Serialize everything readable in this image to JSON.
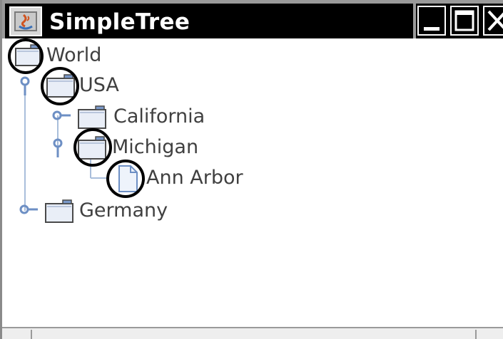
{
  "window": {
    "title": "SimpleTree",
    "controls": [
      "minimize-icon",
      "maximize-icon",
      "close-icon"
    ]
  },
  "tree": {
    "nodes": [
      {
        "label": "World",
        "icon": "folder-icon",
        "depth": 0,
        "handle": "none",
        "marked": true
      },
      {
        "label": "USA",
        "icon": "folder-icon",
        "depth": 1,
        "handle": "expanded",
        "marked": true
      },
      {
        "label": "California",
        "icon": "folder-icon",
        "depth": 2,
        "handle": "collapsed",
        "marked": false
      },
      {
        "label": "Michigan",
        "icon": "folder-icon",
        "depth": 2,
        "handle": "expanded",
        "marked": true
      },
      {
        "label": "Ann Arbor",
        "icon": "file-icon",
        "depth": 3,
        "handle": "none",
        "marked": true
      },
      {
        "label": "Germany",
        "icon": "folder-icon",
        "depth": 1,
        "handle": "collapsed",
        "marked": false
      }
    ]
  },
  "colors": {
    "titlebar": "#000000",
    "title_text": "#ffffff",
    "tree_line": "#a9bedb",
    "handle": "#6d8fc4",
    "folder_fill": "#e9eef7",
    "folder_stroke": "#4a4a4a",
    "folder_tab": "#7a98c9",
    "label_text": "#404040",
    "annotation_circle": "#000000"
  }
}
